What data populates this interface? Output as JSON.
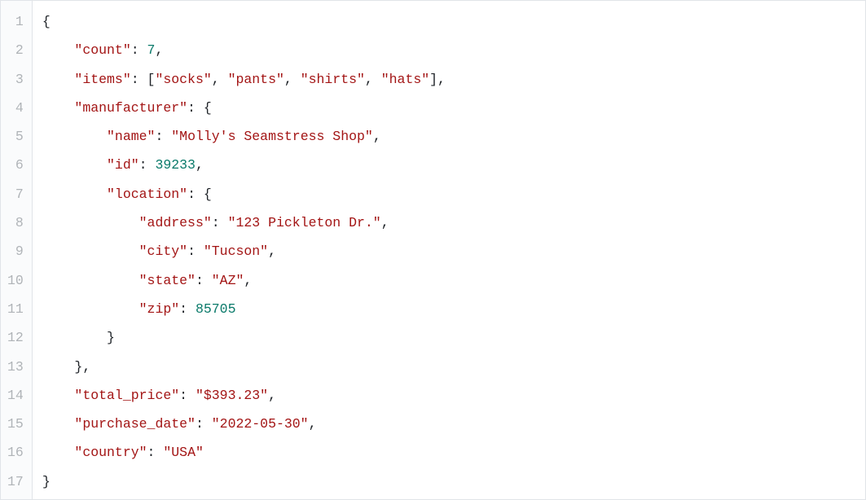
{
  "colors": {
    "key": "#a31515",
    "string": "#a31515",
    "number": "#0a7a6a",
    "punct": "#1f2328",
    "gutter": "#b0b4b8"
  },
  "code_lines": 17,
  "code": [
    {
      "indent": 0,
      "tokens": [
        {
          "t": "{",
          "c": "punct"
        }
      ]
    },
    {
      "indent": 1,
      "tokens": [
        {
          "t": "\"count\"",
          "c": "key"
        },
        {
          "t": ": ",
          "c": "punct"
        },
        {
          "t": "7",
          "c": "num"
        },
        {
          "t": ",",
          "c": "punct"
        }
      ]
    },
    {
      "indent": 1,
      "tokens": [
        {
          "t": "\"items\"",
          "c": "key"
        },
        {
          "t": ": [",
          "c": "punct"
        },
        {
          "t": "\"socks\"",
          "c": "str"
        },
        {
          "t": ", ",
          "c": "punct"
        },
        {
          "t": "\"pants\"",
          "c": "str"
        },
        {
          "t": ", ",
          "c": "punct"
        },
        {
          "t": "\"shirts\"",
          "c": "str"
        },
        {
          "t": ", ",
          "c": "punct"
        },
        {
          "t": "\"hats\"",
          "c": "str"
        },
        {
          "t": "],",
          "c": "punct"
        }
      ]
    },
    {
      "indent": 1,
      "tokens": [
        {
          "t": "\"manufacturer\"",
          "c": "key"
        },
        {
          "t": ": {",
          "c": "punct"
        }
      ]
    },
    {
      "indent": 2,
      "tokens": [
        {
          "t": "\"name\"",
          "c": "key"
        },
        {
          "t": ": ",
          "c": "punct"
        },
        {
          "t": "\"Molly's Seamstress Shop\"",
          "c": "str"
        },
        {
          "t": ",",
          "c": "punct"
        }
      ]
    },
    {
      "indent": 2,
      "tokens": [
        {
          "t": "\"id\"",
          "c": "key"
        },
        {
          "t": ": ",
          "c": "punct"
        },
        {
          "t": "39233",
          "c": "num"
        },
        {
          "t": ",",
          "c": "punct"
        }
      ]
    },
    {
      "indent": 2,
      "tokens": [
        {
          "t": "\"location\"",
          "c": "key"
        },
        {
          "t": ": {",
          "c": "punct"
        }
      ]
    },
    {
      "indent": 3,
      "tokens": [
        {
          "t": "\"address\"",
          "c": "key"
        },
        {
          "t": ": ",
          "c": "punct"
        },
        {
          "t": "\"123 Pickleton Dr.\"",
          "c": "str"
        },
        {
          "t": ",",
          "c": "punct"
        }
      ]
    },
    {
      "indent": 3,
      "tokens": [
        {
          "t": "\"city\"",
          "c": "key"
        },
        {
          "t": ": ",
          "c": "punct"
        },
        {
          "t": "\"Tucson\"",
          "c": "str"
        },
        {
          "t": ",",
          "c": "punct"
        }
      ]
    },
    {
      "indent": 3,
      "tokens": [
        {
          "t": "\"state\"",
          "c": "key"
        },
        {
          "t": ": ",
          "c": "punct"
        },
        {
          "t": "\"AZ\"",
          "c": "str"
        },
        {
          "t": ",",
          "c": "punct"
        }
      ]
    },
    {
      "indent": 3,
      "tokens": [
        {
          "t": "\"zip\"",
          "c": "key"
        },
        {
          "t": ": ",
          "c": "punct"
        },
        {
          "t": "85705",
          "c": "num"
        }
      ]
    },
    {
      "indent": 2,
      "tokens": [
        {
          "t": "}",
          "c": "punct"
        }
      ]
    },
    {
      "indent": 1,
      "tokens": [
        {
          "t": "},",
          "c": "punct"
        }
      ]
    },
    {
      "indent": 1,
      "tokens": [
        {
          "t": "\"total_price\"",
          "c": "key"
        },
        {
          "t": ": ",
          "c": "punct"
        },
        {
          "t": "\"$393.23\"",
          "c": "str"
        },
        {
          "t": ",",
          "c": "punct"
        }
      ]
    },
    {
      "indent": 1,
      "tokens": [
        {
          "t": "\"purchase_date\"",
          "c": "key"
        },
        {
          "t": ": ",
          "c": "punct"
        },
        {
          "t": "\"2022-05-30\"",
          "c": "str"
        },
        {
          "t": ",",
          "c": "punct"
        }
      ]
    },
    {
      "indent": 1,
      "tokens": [
        {
          "t": "\"country\"",
          "c": "key"
        },
        {
          "t": ": ",
          "c": "punct"
        },
        {
          "t": "\"USA\"",
          "c": "str"
        }
      ]
    },
    {
      "indent": 0,
      "tokens": [
        {
          "t": "}",
          "c": "punct"
        }
      ]
    }
  ],
  "json_value": {
    "count": 7,
    "items": [
      "socks",
      "pants",
      "shirts",
      "hats"
    ],
    "manufacturer": {
      "name": "Molly's Seamstress Shop",
      "id": 39233,
      "location": {
        "address": "123 Pickleton Dr.",
        "city": "Tucson",
        "state": "AZ",
        "zip": 85705
      }
    },
    "total_price": "$393.23",
    "purchase_date": "2022-05-30",
    "country": "USA"
  }
}
